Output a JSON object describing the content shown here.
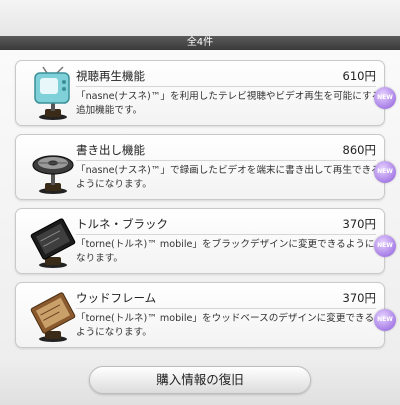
{
  "header": {
    "count_label": "全4件"
  },
  "items": [
    {
      "name": "視聴再生機能",
      "price": "610円",
      "description": "「nasne(ナスネ)™」を利用したテレビ視聴やビデオ再生を可能にする追加機能です。",
      "badge": "NEW",
      "icon": "retro-tv-figure-icon"
    },
    {
      "name": "書き出し機能",
      "price": "860円",
      "description": "「nasne(ナスネ)™」で録画したビデオを端末に書き出して再生できるようになります。",
      "badge": "NEW",
      "icon": "film-reel-figure-icon"
    },
    {
      "name": "トルネ・ブラック",
      "price": "370円",
      "description": "「torne(トルネ)™ mobile」をブラックデザインに変更できるようになります。",
      "badge": "NEW",
      "icon": "black-panel-figure-icon"
    },
    {
      "name": "ウッドフレーム",
      "price": "370円",
      "description": "「torne(トルネ)™ mobile」をウッドベースのデザインに変更できるようになります。",
      "badge": "NEW",
      "icon": "wood-panel-figure-icon"
    }
  ],
  "footer": {
    "restore_label": "購入情報の復旧"
  },
  "colors": {
    "badge": "#a77ee6",
    "count_bar": "#444444"
  }
}
